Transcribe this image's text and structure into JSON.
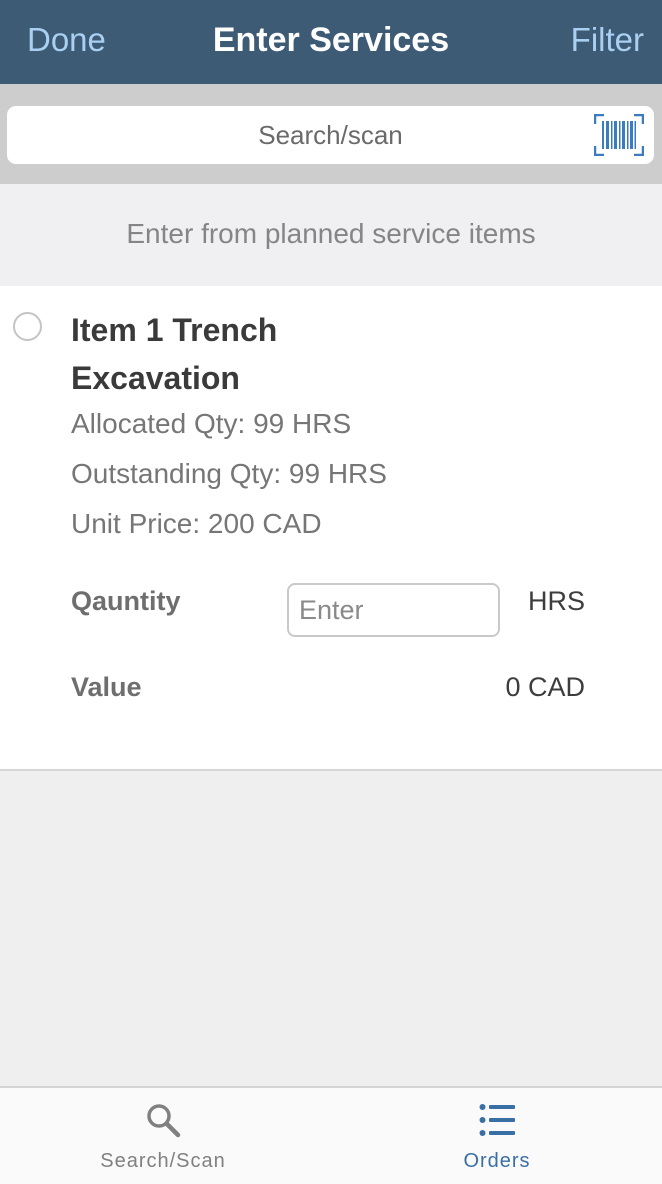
{
  "header": {
    "left_label": "Done",
    "title": "Enter Services",
    "right_label": "Filter"
  },
  "search": {
    "placeholder": "Search/scan",
    "scan_icon": "barcode-icon"
  },
  "section": {
    "title": "Enter from planned service items"
  },
  "item": {
    "title_line1": "Item 1 Trench",
    "title_line2": "Excavation",
    "allocated": "Allocated Qty: 99 HRS",
    "outstanding": "Outstanding Qty: 99 HRS",
    "unit_price": "Unit Price: 200 CAD",
    "quantity_label": "Qauntity",
    "quantity_placeholder": "Enter",
    "quantity_value": "",
    "quantity_unit": "HRS",
    "value_label": "Value",
    "value": "0 CAD",
    "selected": false
  },
  "tabs": [
    {
      "label": "Search/Scan",
      "icon": "search-icon",
      "active": false,
      "color": "#808080"
    },
    {
      "label": "Orders",
      "icon": "list-icon",
      "active": true,
      "color": "#3a6fa5"
    }
  ],
  "colors": {
    "nav_bg": "#3e5b75",
    "nav_link": "#a9d0f2",
    "accent": "#3a6fa5",
    "barcode": "#3b7cc0"
  }
}
